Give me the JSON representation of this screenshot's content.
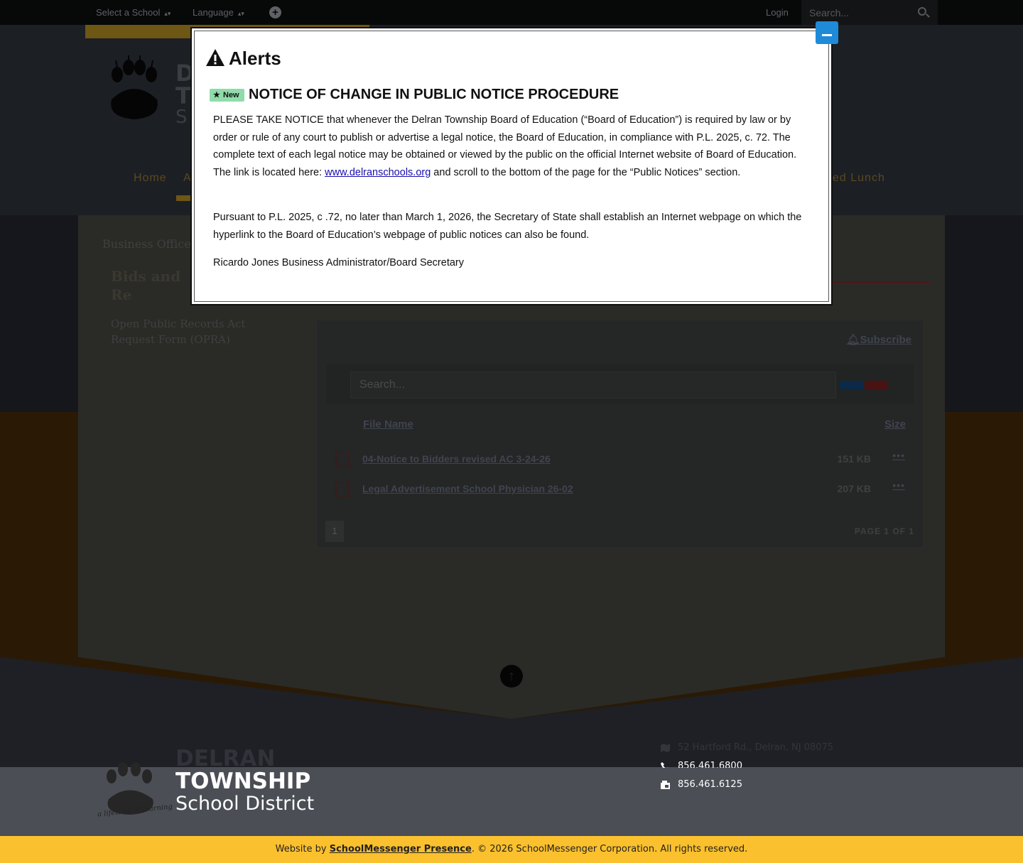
{
  "topbar": {
    "select_school": "Select a School",
    "language": "Language",
    "login": "Login",
    "search_placeholder": "Search..."
  },
  "header": {
    "title_letters": [
      "D",
      "T",
      "S"
    ]
  },
  "nav": {
    "home": "Home",
    "partial_item": "A",
    "partial_lunch": "ed Lunch"
  },
  "breadcrumb": "Business Office",
  "sidebar": {
    "title": "Bids and Re Proposals",
    "opra": "Open Public Records Act Request Form (OPRA)"
  },
  "files": {
    "subscribe": "Subscribe",
    "search_placeholder": "Search...",
    "columns": {
      "name": "File Name",
      "size": "Size"
    },
    "rows": [
      {
        "name": "04-Notice to Bidders revised AC 3-24-26",
        "size": "151 KB",
        "more": "•••"
      },
      {
        "name": "Legal Advertisement School Physician 26-02",
        "size": "207 KB",
        "more": "•••"
      }
    ],
    "page_button": "1",
    "page_info": "PAGE 1 OF 1"
  },
  "footer": {
    "delran": "DELRAN",
    "township": "TOWNSHIP",
    "school_district": "School District",
    "address": "52 Hartford Rd., Delran, NJ 08075",
    "phone": "856.461.6800",
    "fax": "856.461.6125",
    "logo_tagline": "a lifetime of learning"
  },
  "copyright": {
    "prefix": "Website by ",
    "link": "SchoolMessenger Presence",
    "suffix": ". © 2026 SchoolMessenger Corporation. All rights reserved."
  },
  "modal": {
    "title": "Alerts",
    "badge": "New",
    "notice_title": "NOTICE OF CHANGE IN PUBLIC NOTICE PROCEDURE",
    "p1_before": "PLEASE TAKE NOTICE that whenever the Delran Township Board of Education (“Board of Education”) is required by law or by order or rule of any court to publish or advertise a legal notice, the Board of Education, in compliance with P.L. 2025, c. 72. The complete text of each legal notice may be obtained or viewed by the public on the official Internet website of Board of Education. The link is located here: ",
    "p1_link": "www.delranschools.org",
    "p1_after": " and scroll to the bottom of the page for the “Public Notices” section.",
    "p2": "Pursuant to P.L. 2025, c .72, no later than March 1, 2026, the Secretary of State shall establish an Internet webpage on which the hyperlink to the Board of Education’s webpage of public notices can also be found.",
    "p3": "Ricardo Jones Business Administrator/Board Secretary"
  },
  "colors": {
    "accent_yellow": "#fbc02d",
    "badge_green": "#8fdcaa",
    "minimize_blue": "#1f8ad8",
    "link_blue": "#1a0dab"
  }
}
